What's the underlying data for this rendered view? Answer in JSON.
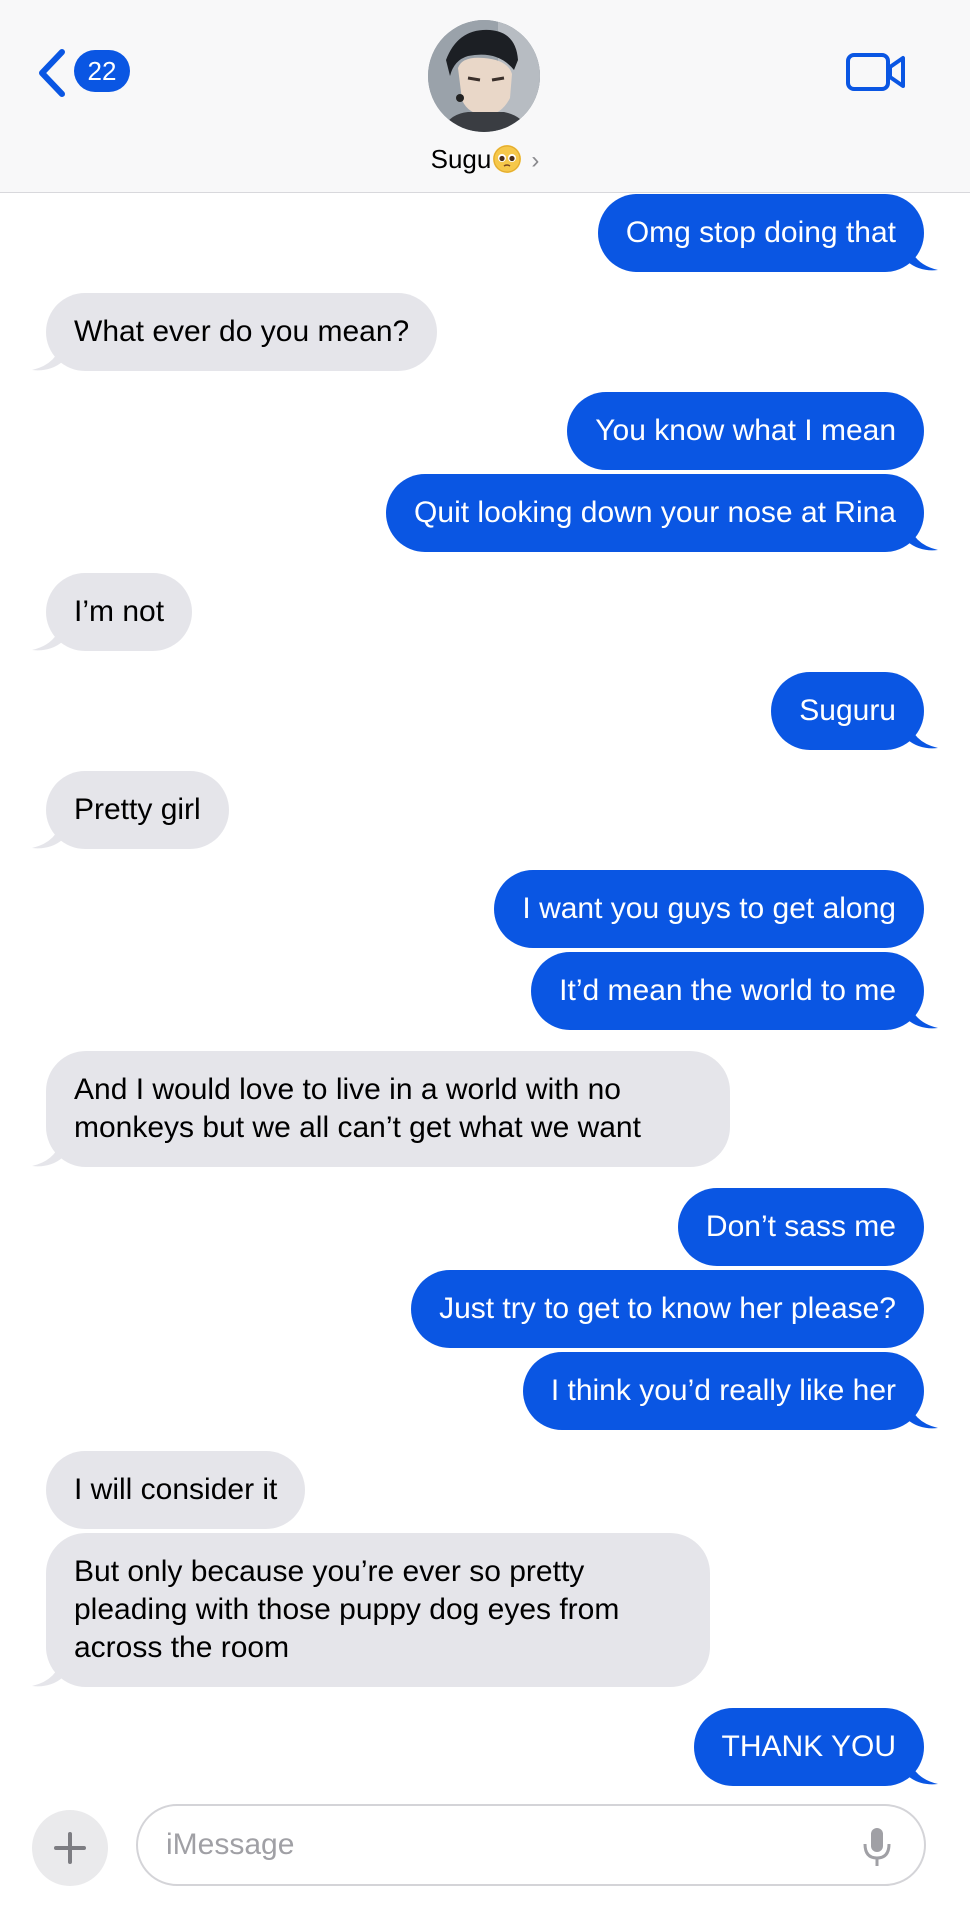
{
  "header": {
    "back_count": "22",
    "contact_name": "Sugu",
    "contact_emoji_icon": "pleading-face-emoji",
    "chevron": "›"
  },
  "messages": [
    {
      "from": "me",
      "text": "Omg stop doing that"
    },
    {
      "from": "them",
      "text": "What ever do you mean?"
    },
    {
      "from": "me",
      "text": "You know what I mean"
    },
    {
      "from": "me",
      "text": "Quit looking down your nose at Rina"
    },
    {
      "from": "them",
      "text": "I’m not"
    },
    {
      "from": "me",
      "text": "Suguru"
    },
    {
      "from": "them",
      "text": "Pretty girl"
    },
    {
      "from": "me",
      "text": "I want you guys to get along"
    },
    {
      "from": "me",
      "text": "It’d mean the world to me"
    },
    {
      "from": "them",
      "text": "And I would love to live in a world with no monkeys but we all can’t get what we want"
    },
    {
      "from": "me",
      "text": "Don’t sass me"
    },
    {
      "from": "me",
      "text": "Just try to get to know her please?"
    },
    {
      "from": "me",
      "text": "I think you’d really like her"
    },
    {
      "from": "them",
      "text": "I will consider it"
    },
    {
      "from": "them",
      "text": "But only because you’re ever so pretty pleading with those puppy dog eyes from across the room"
    },
    {
      "from": "me",
      "text": "THANK YOU"
    }
  ],
  "composer": {
    "placeholder": "iMessage"
  },
  "colors": {
    "sent_bubble": "#0a56e3",
    "received_bubble": "#e5e5ea",
    "accent": "#0a56e3"
  }
}
